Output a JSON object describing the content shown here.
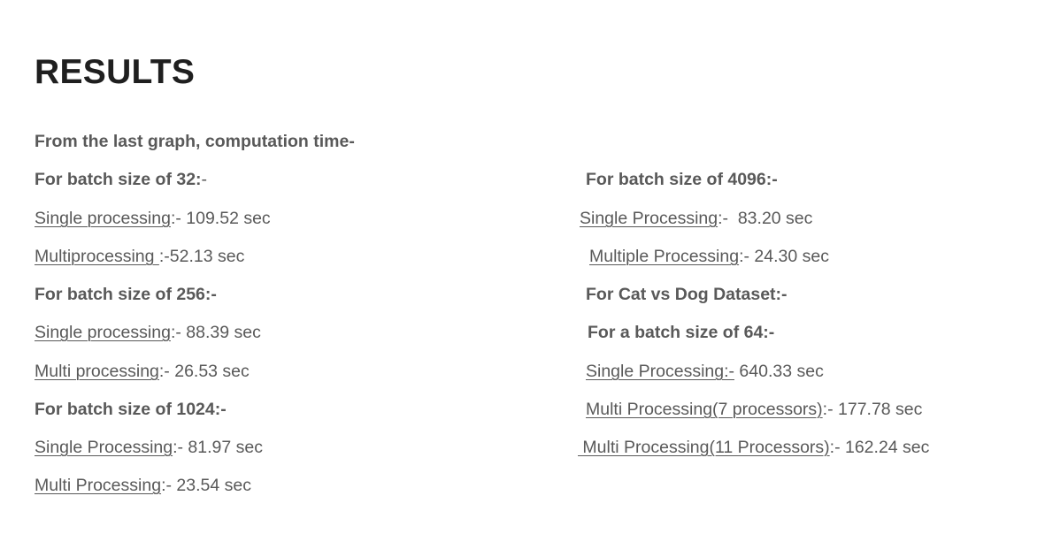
{
  "title": "RESULTS",
  "intro": "From the last graph, computation time-",
  "left": {
    "batch32": {
      "heading_bold": "For batch size of 32:",
      "heading_rest": "-",
      "single_label": "Single processing",
      "single_value": ":- 109.52 sec",
      "multi_label": "Multiprocessing ",
      "multi_value": ":-52.13 sec"
    },
    "batch256": {
      "heading": "For batch size of 256:-",
      "single_label": "Single processing",
      "single_value": ":- 88.39 sec",
      "multi_label": "Multi processing",
      "multi_value": ":- 26.53 sec"
    },
    "batch1024": {
      "heading": "For batch size of 1024:-",
      "single_label": "Single Processing",
      "single_value": ":- 81.97 sec",
      "multi_label": "Multi Processing",
      "multi_value": ":- 23.54 sec"
    }
  },
  "right": {
    "batch4096": {
      "heading": "For batch size of 4096:-",
      "single_label": "Single Processing",
      "single_value": ":-  83.20 sec",
      "multi_label": "Multiple Processing",
      "multi_value": ":- 24.30 sec"
    },
    "catdog": {
      "heading": "For Cat vs Dog Dataset:-",
      "subheading": "For a batch size of 64:-",
      "single_label": "Single Processing:-",
      "single_value": " 640.33 sec",
      "multi7_label": "Multi Processing(7 processors)",
      "multi7_value": ":- 177.78 sec",
      "multi11_label": " Multi Processing(11 Processors)",
      "multi11_value": ":- 162.24 sec"
    }
  }
}
